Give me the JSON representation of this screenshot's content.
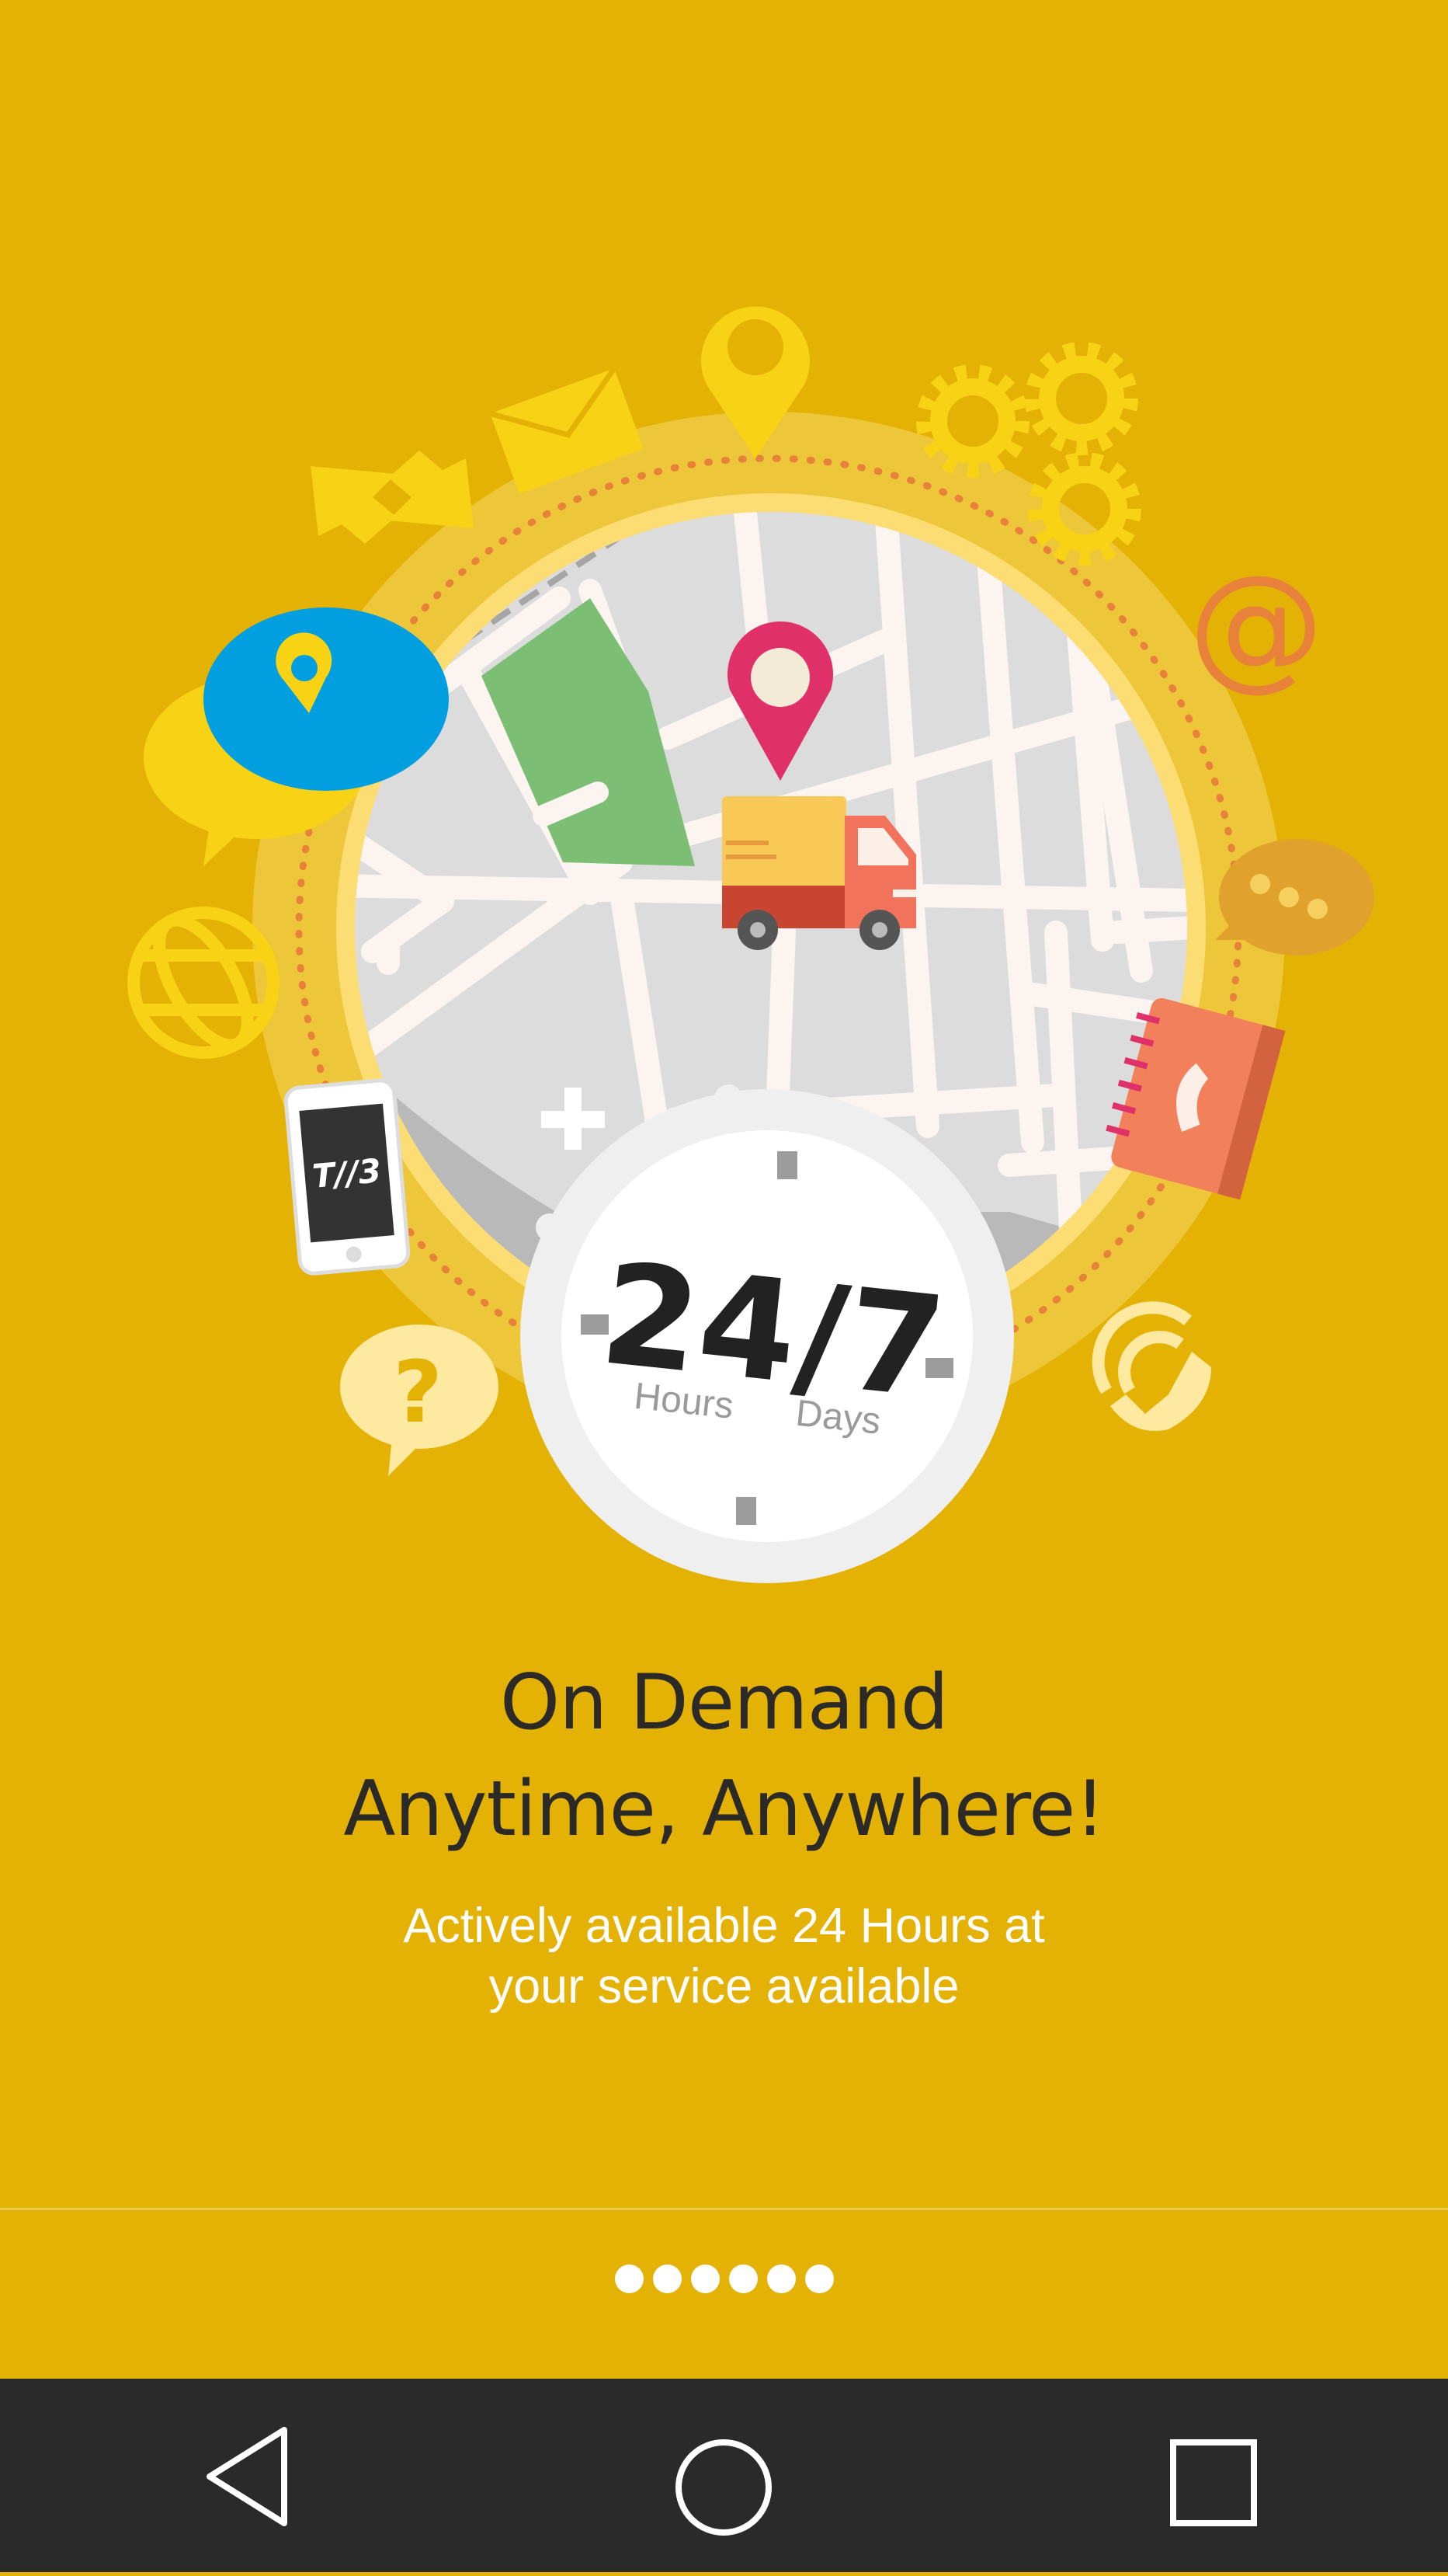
{
  "illustration": {
    "phone_logo": "T//3",
    "clock": {
      "big": "24/7",
      "hours_label": "Hours",
      "days_label": "Days"
    },
    "email_icon_glyph": "@",
    "question_glyph": "?"
  },
  "headline": {
    "line1": "On Demand",
    "line2": "Anytime, Anywhere!"
  },
  "description": {
    "line1": "Actively available 24 Hours at",
    "line2": "your service available"
  },
  "pagination": {
    "dots": 6
  },
  "navbar": {
    "back": "back-icon",
    "home": "home-icon",
    "recents": "recents-icon"
  },
  "colors": {
    "background": "#E4B105",
    "navbar": "#2A2A2A",
    "headline": "#2B2A27",
    "pin": "#E0306A",
    "truck": "#F2735C",
    "map_park": "#7CBF74",
    "chat_blue": "#029FE0"
  }
}
